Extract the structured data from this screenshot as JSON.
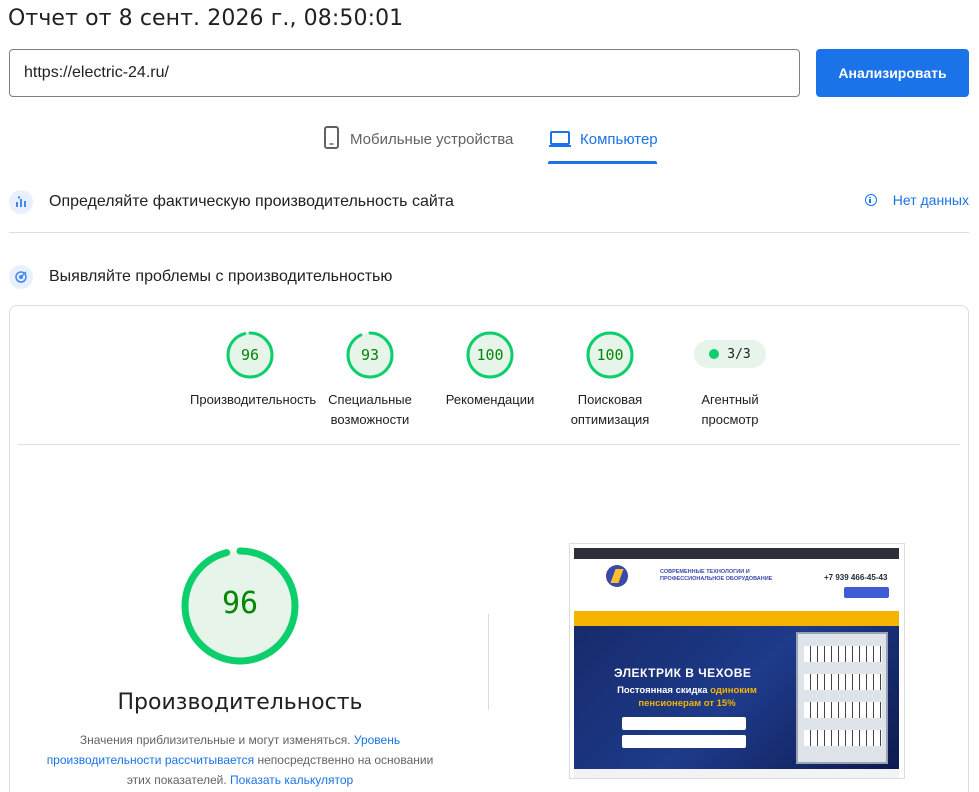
{
  "report_title": "Отчет от 8 сент. 2026 г., 08:50:01",
  "url_input": {
    "value": "https://electric-24.ru/"
  },
  "analyze_button": "Анализировать",
  "tabs": [
    {
      "label": "Мобильные устройства",
      "icon": "smartphone-icon",
      "active": false
    },
    {
      "label": "Компьютер",
      "icon": "laptop-icon",
      "active": true
    }
  ],
  "field_data": {
    "title": "Определяйте фактическую производительность сайта",
    "no_data_link": "Нет данных"
  },
  "lab_data": {
    "title": "Выявляйте проблемы с производительностью"
  },
  "scores": [
    {
      "value": "96",
      "label_line1": "Производительность",
      "label_line2": "",
      "fraction": 0.96
    },
    {
      "value": "93",
      "label_line1": "Специальные",
      "label_line2": "возможности",
      "fraction": 0.93
    },
    {
      "value": "100",
      "label_line1": "Рекомендации",
      "label_line2": "",
      "fraction": 1.0
    },
    {
      "value": "100",
      "label_line1": "Поисковая",
      "label_line2": "оптимизация",
      "fraction": 1.0
    }
  ],
  "agent": {
    "badge": "3/3",
    "label_line1": "Агентный",
    "label_line2": "просмотр"
  },
  "performance": {
    "score": "96",
    "fraction": 0.96,
    "title": "Производительность",
    "note_prefix": "Значения приблизительные и могут изменяться.",
    "note_link1": "Уровень производительности рассчитывается",
    "note_middle": "непосредственно на основании этих показателей.",
    "note_link2": "Показать калькулятор"
  },
  "screenshot": {
    "tagline": "СОВРЕМЕННЫЕ ТЕХНОЛОГИИ И ПРОФЕССИОНАЛЬНОЕ ОБОРУДОВАНИЕ",
    "phone": "+7 939 466-45-43",
    "hero_title": "ЭЛЕКТРИК В ЧЕХОВЕ",
    "hero_sub_1": "Постоянная скидка",
    "hero_sub_hl": "одиноким пенсионерам от 15%"
  },
  "colors": {
    "accent": "#1a73e8",
    "pass_green": "#0cce6b",
    "pass_text": "#008800",
    "pass_fill": "#e6f4ea"
  }
}
